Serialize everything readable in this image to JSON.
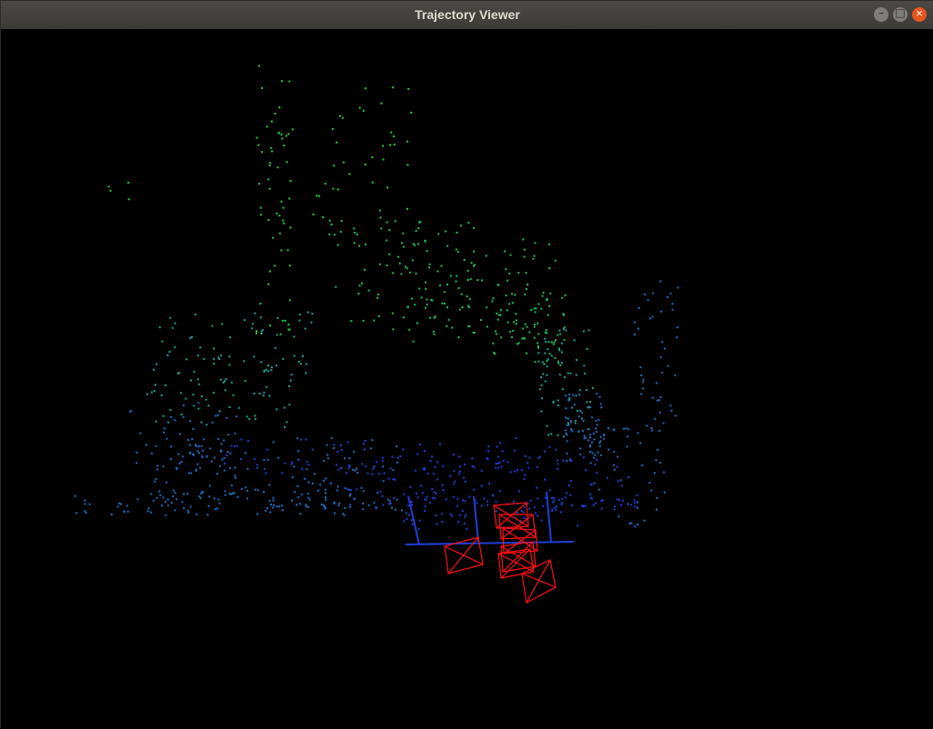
{
  "window": {
    "title": "Trajectory Viewer",
    "buttons": {
      "minimize": "–",
      "maximize": "□",
      "close": "×"
    }
  },
  "viewport": {
    "background": "#000000",
    "point_colors": [
      "#1e3fd6",
      "#1c6fc0",
      "#1aa39a",
      "#1ec05c",
      "#22d23a"
    ],
    "camera_frame_color": "#ff1010"
  }
}
